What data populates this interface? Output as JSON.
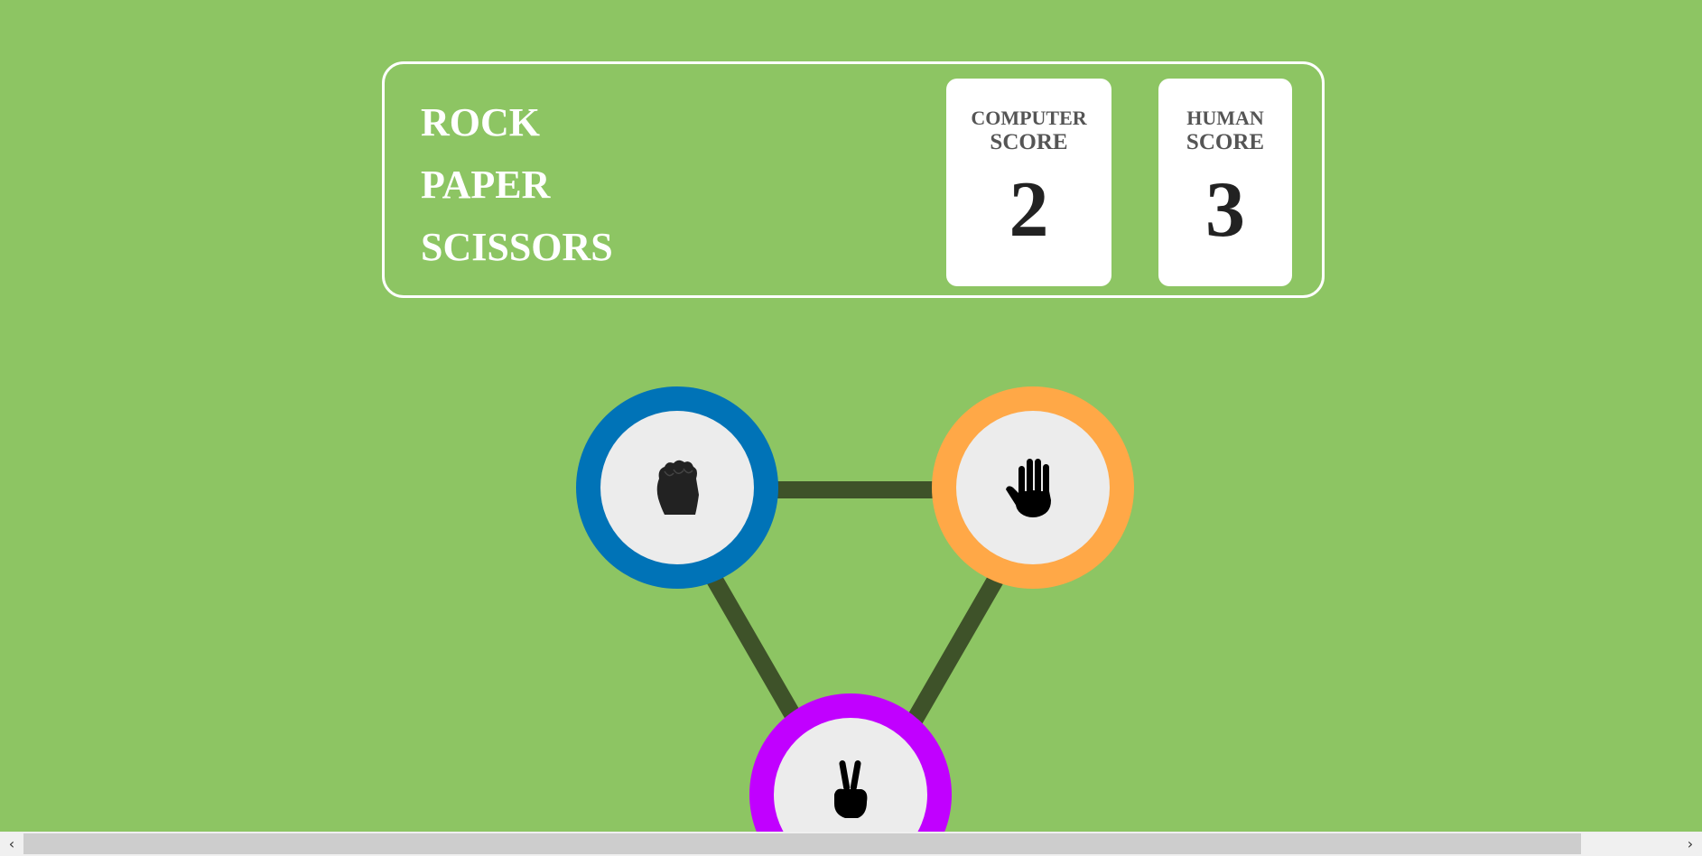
{
  "header": {
    "title_lines": [
      "ROCK",
      "PAPER",
      "SCISSORS"
    ],
    "computer_score": {
      "label_top": "COMPUTER",
      "label_bottom": "SCORE",
      "value": "2"
    },
    "human_score": {
      "label_top": "HUMAN",
      "label_bottom": "SCORE",
      "value": "3"
    }
  },
  "choices": [
    {
      "name": "rock",
      "icon": "rock-fist-icon",
      "ring_color": "#0073b7"
    },
    {
      "name": "paper",
      "icon": "paper-hand-icon",
      "ring_color": "#ffa847"
    },
    {
      "name": "scissors",
      "icon": "scissors-peace-icon",
      "ring_color": "#c100ff"
    }
  ],
  "colors": {
    "background": "#8dc563",
    "connector": "#3e5229",
    "icon_bg": "#ececec"
  },
  "scrollbar": {
    "left_arrow": "‹",
    "right_arrow": "›"
  }
}
